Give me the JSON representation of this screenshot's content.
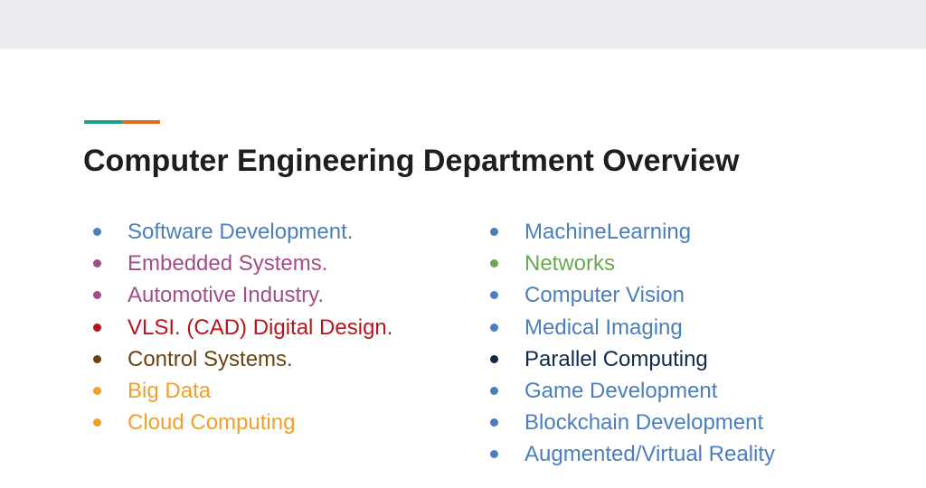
{
  "slide": {
    "title": "Computer Engineering Department Overview",
    "accent_colors": [
      "#1f9e89",
      "#e26a1b"
    ]
  },
  "left_list": [
    {
      "label": "Software Development.",
      "color": "#4a7ebf"
    },
    {
      "label": "Embedded Systems.",
      "color": "#a24d8a"
    },
    {
      "label": "Automotive Industry.",
      "color": "#a24d8a"
    },
    {
      "label": "VLSI. (CAD) Digital Design.",
      "color": "#b8141a"
    },
    {
      "label": "Control Systems.",
      "color": "#6b4312"
    },
    {
      "label": "Big Data",
      "color": "#f0a02a"
    },
    {
      "label": "Cloud Computing",
      "color": "#f0a02a"
    }
  ],
  "right_list": [
    {
      "label": "MachineLearning",
      "color": "#4a7ebf"
    },
    {
      "label": "Networks",
      "color": "#6aa84f"
    },
    {
      "label": "Computer Vision",
      "color": "#4a7ebf"
    },
    {
      "label": "Medical Imaging",
      "color": "#4a7ebf"
    },
    {
      "label": "Parallel Computing",
      "color": "#0f2a4a"
    },
    {
      "label": "Game Development",
      "color": "#4a7ebf"
    },
    {
      "label": "Blockchain Development",
      "color": "#4a7ebf"
    },
    {
      "label": "Augmented/Virtual Reality",
      "color": "#4a7ebf"
    }
  ]
}
